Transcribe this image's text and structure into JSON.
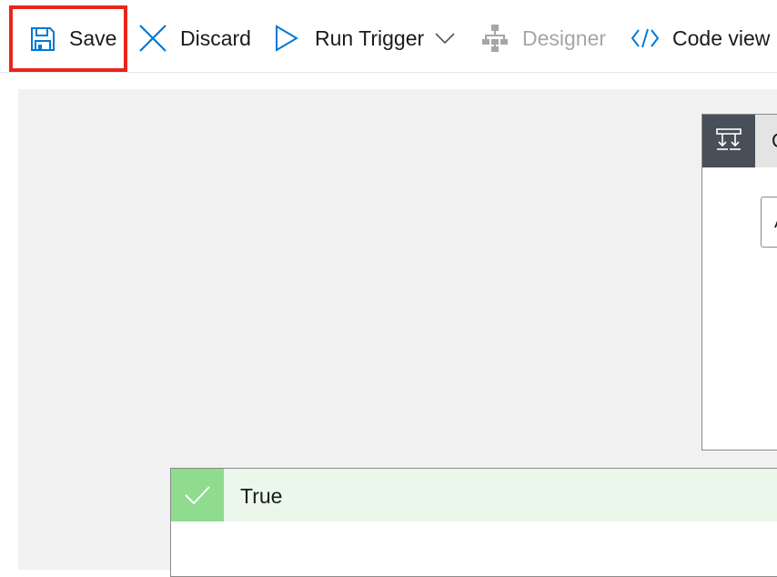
{
  "toolbar": {
    "save_label": "Save",
    "discard_label": "Discard",
    "run_trigger_label": "Run Trigger",
    "designer_label": "Designer",
    "code_view_label": "Code view",
    "icons": {
      "save": "floppy-disk-icon",
      "discard": "close-icon",
      "run": "play-icon",
      "run_menu": "chevron-down-icon",
      "designer": "org-chart-icon",
      "code_view": "code-brackets-icon"
    },
    "accent_color": "#0078d4",
    "highlight_color": "#e8261b"
  },
  "condition_card": {
    "title": "C",
    "input_value": "A",
    "icon": "condition-icon",
    "icon_bg": "#484f58"
  },
  "true_branch": {
    "title": "True",
    "icon": "checkmark-icon",
    "icon_bg": "#8fdc8f",
    "header_bg": "#eaf7ea"
  }
}
